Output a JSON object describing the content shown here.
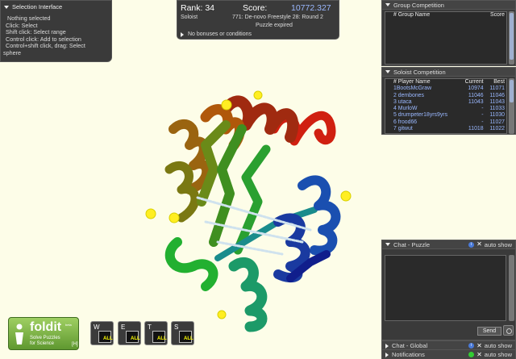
{
  "selection_panel": {
    "title": "Selection Interface",
    "lines": [
      "Nothing selected",
      "Click: Select",
      "Shift click: Select range",
      "Control click: Add to selection",
      "Control+shift click, drag: Select",
      "sphere"
    ]
  },
  "score_panel": {
    "rank_label": "Rank: 34",
    "score_label": "Score:",
    "score_value": "10772.327",
    "mode": "Soloist",
    "puzzle_name": "771: De-novo Freestyle 28: Round 2",
    "status": "Puzzle expired",
    "bonuses": "No bonuses or conditions"
  },
  "group_competition": {
    "title": "Group Competition",
    "columns": [
      "# Group Name",
      "Score"
    ]
  },
  "soloist_competition": {
    "title": "Soloist Competition",
    "columns": [
      "# Player Name",
      "Current",
      "Best"
    ],
    "rows": [
      {
        "rank_name": "1BootsMcGraw",
        "current": "10974",
        "best": "11071"
      },
      {
        "rank_name": "2 dembones",
        "current": "11046",
        "best": "11046"
      },
      {
        "rank_name": "3 utaca",
        "current": "11043",
        "best": "11043"
      },
      {
        "rank_name": "4 MurloW",
        "current": "-",
        "best": "11033"
      },
      {
        "rank_name": "5 drumpeter18yrs9yrs",
        "current": "-",
        "best": "11030"
      },
      {
        "rank_name": "6 frood66",
        "current": "-",
        "best": "11027"
      },
      {
        "rank_name": "7 gitwut",
        "current": "11018",
        "best": "11022"
      }
    ]
  },
  "chat_puzzle": {
    "title": "Chat - Puzzle",
    "auto_show": "auto show",
    "send_label": "Send"
  },
  "chat_global": {
    "title": "Chat - Global",
    "auto_show": "auto show"
  },
  "notifications": {
    "title": "Notifications",
    "auto_show": "auto show"
  },
  "logo": {
    "word": "foldit",
    "tagline_1": "Solve Puzzles",
    "tagline_2": "for Science",
    "badge": "[H]",
    "beta": "beta"
  },
  "tools": [
    {
      "letter": "W",
      "all": "ALL"
    },
    {
      "letter": "E",
      "all": "ALL"
    },
    {
      "letter": "T",
      "all": "ALL"
    },
    {
      "letter": "S",
      "all": "ALL"
    }
  ],
  "colors": {
    "background": "#fdfde8",
    "panel": "#3a3a3a",
    "score_accent": "#9ab8ff",
    "logo_green": "#7fb94a"
  }
}
